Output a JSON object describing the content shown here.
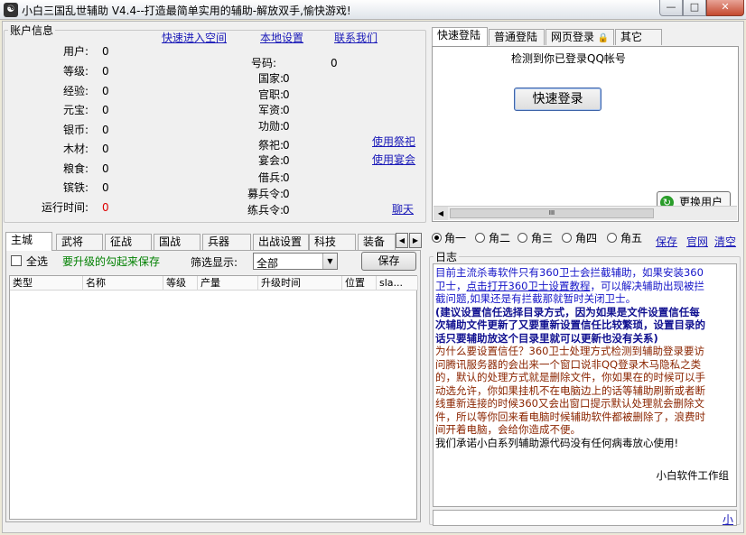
{
  "window": {
    "title": "小白三国乱世辅助 V4.4--打造最简单实用的辅助-解放双手,愉快游戏!",
    "icon": "app-icon",
    "min_glyph": "—",
    "max_glyph": "□",
    "close_glyph": "✕"
  },
  "account": {
    "legend": "账户信息",
    "links": {
      "space": "快速进入空间",
      "settings": "本地设置",
      "contact": "联系我们",
      "use_sacrifice": "使用祭祀",
      "use_banquet": "使用宴会",
      "chat": "聊天"
    },
    "left_labels": [
      "用户:",
      "等级:",
      "经验:",
      "元宝:",
      "银币:",
      "木材:",
      "粮食:",
      "镔铁:",
      "运行时间:"
    ],
    "left_values": [
      "0",
      "0",
      "0",
      "0",
      "0",
      "0",
      "0",
      "0",
      "0"
    ],
    "mid_labels": [
      "号码:",
      "国家:",
      "官职:",
      "军资:",
      "功勋:",
      "祭祀:",
      "宴会:",
      "借兵:",
      "募兵令:",
      "练兵令:"
    ],
    "mid_values": [
      "0",
      "0",
      "0",
      "0",
      "0",
      "0",
      "0",
      "0",
      "0",
      "0"
    ],
    "runtime_color": "#dd0000"
  },
  "login": {
    "tabs": [
      "快速登陆",
      "普通登陆",
      "网页登录",
      "其它"
    ],
    "detected_text": "检测到你已登录QQ帐号",
    "quick_login_button": "快速登录",
    "change_user_button": "更换用户",
    "scroll_glyph": "III"
  },
  "roles": {
    "options": [
      "角一",
      "角二",
      "角三",
      "角四",
      "角五"
    ],
    "selected_index": 0,
    "links": {
      "save": "保存",
      "website": "官网",
      "clear": "清空"
    }
  },
  "main": {
    "tabs": [
      "主城",
      "武将",
      "征战",
      "国战",
      "兵器",
      "出战设置",
      "科技",
      "装备"
    ],
    "select_all_label": "全选",
    "hint_text": "要升级的勾起来保存",
    "filter_label": "筛选显示:",
    "filter_value": "全部",
    "save_button": "保存",
    "columns": [
      "类型",
      "名称",
      "等级",
      "产量",
      "升级时间",
      "位置",
      "sla..."
    ],
    "hint_color": "#008000"
  },
  "log": {
    "legend": "日志",
    "p1_pre": "目前主流杀毒软件只有360卫士会拦截辅助，如果安装360卫士，",
    "p1_link": "点击打开360卫士设置教程",
    "p1_post": "，可以解决辅助出现被拦截问题,如果还是有拦截那就暂时关闭卫士。",
    "p2": "(建议设置信任选择目录方式，因为如果是文件设置信任每次辅助文件更新了又要重新设置信任比较繁琐，设置目录的话只要辅助放这个目录里就可以更新也没有关系)",
    "p3": "为什么要设置信任？360卫士处理方式检测到辅助登录要访问腾讯服务器的会出来一个窗口说非QQ登录木马隐私之类的，默认的处理方式就是删除文件，你如果在的时候可以手动选允许，你如果挂机不在电脑边上的话等辅助刷新或者断线重新连接的时候360又会出窗口提示默认处理就会删除文件，所以等你回来看电脑时候辅助软件都被删除了，浪费时间开着电脑，会给你造成不便。",
    "p4": "我们承诺小白系列辅助源代码没有任何病毒放心使用!",
    "signature": "小白软件工作组",
    "bottom_link": "小",
    "colors": {
      "blue": "#1515c8",
      "dark_blue": "#101090",
      "brown": "#8b2500",
      "black": "#000000"
    }
  }
}
